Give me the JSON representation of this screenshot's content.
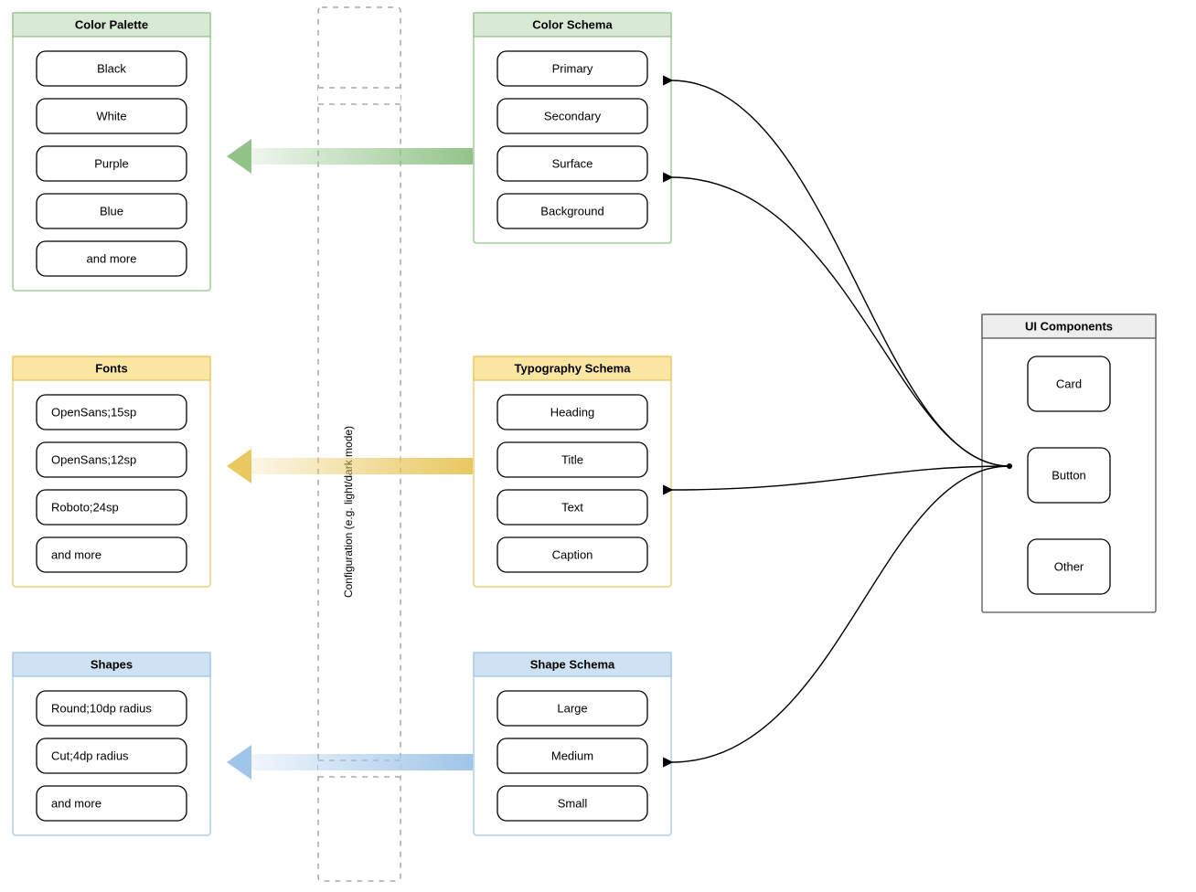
{
  "colors": {
    "greenFill": "#d8ead3",
    "greenStroke": "#92c489",
    "yellowFill": "#fbe6a3",
    "yellowStroke": "#e8c85f",
    "blueFill": "#cfe2f3",
    "blueStroke": "#9fc5e8",
    "grayFill": "#eeeeee",
    "grayStroke": "#777777"
  },
  "configLabel": "Configuration (e.g. light/dark mode)",
  "colorPalette": {
    "title": "Color Palette",
    "items": [
      "Black",
      "White",
      "Purple",
      "Blue",
      "and more"
    ]
  },
  "fonts": {
    "title": "Fonts",
    "items": [
      "OpenSans;15sp",
      "OpenSans;12sp",
      "Roboto;24sp",
      "and more"
    ]
  },
  "shapes": {
    "title": "Shapes",
    "items": [
      "Round;10dp radius",
      "Cut;4dp radius",
      "and more"
    ]
  },
  "colorSchema": {
    "title": "Color Schema",
    "items": [
      "Primary",
      "Secondary",
      "Surface",
      "Background"
    ]
  },
  "typographySchema": {
    "title": "Typography Schema",
    "items": [
      "Heading",
      "Title",
      "Text",
      "Caption"
    ]
  },
  "shapeSchema": {
    "title": "Shape Schema",
    "items": [
      "Large",
      "Medium",
      "Small"
    ]
  },
  "uiComponents": {
    "title": "UI Components",
    "items": [
      "Card",
      "Button",
      "Other"
    ]
  }
}
